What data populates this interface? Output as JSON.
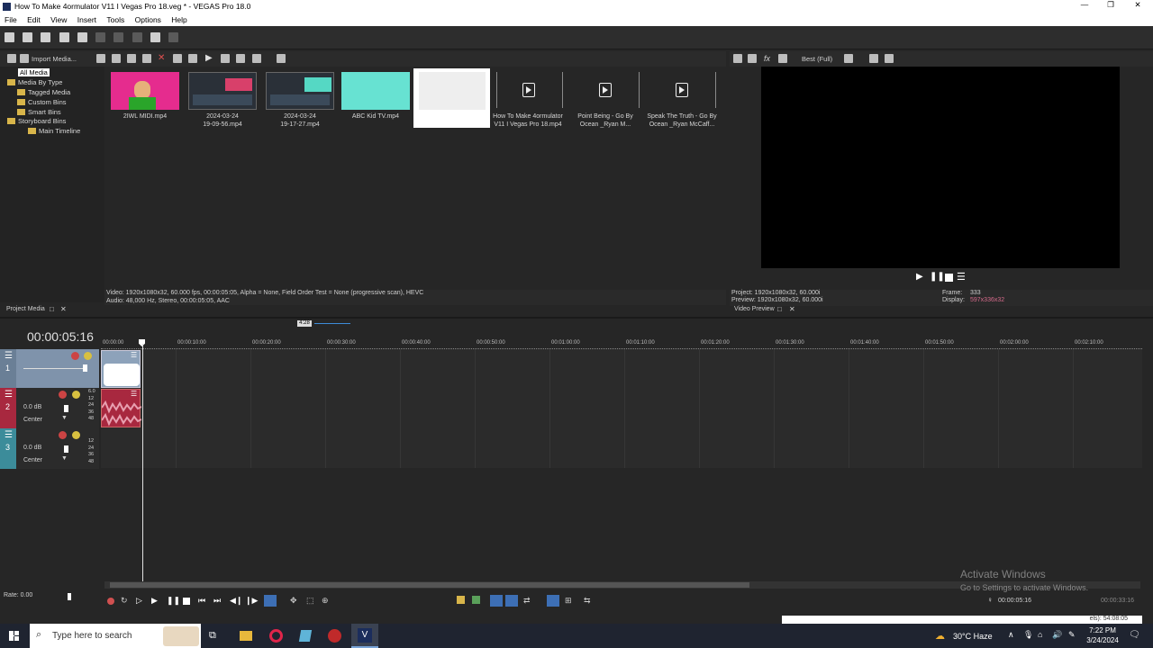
{
  "window": {
    "title": "How To Make 4ormulator V11 I Vegas Pro 18.veg * - VEGAS Pro 18.0"
  },
  "menu": [
    "File",
    "Edit",
    "View",
    "Insert",
    "Tools",
    "Options",
    "Help"
  ],
  "project_media": {
    "import_label": "Import Media...",
    "tree": [
      "All Media",
      "Media By Type",
      "Tagged Media",
      "Custom Bins",
      "Smart Bins",
      "Storyboard Bins",
      "Main Timeline"
    ],
    "items": [
      {
        "label": "2IWL MIDI.mp4"
      },
      {
        "label": "2024-03-24\n19-09-56.mp4"
      },
      {
        "label": "2024-03-24\n19-17-27.mp4"
      },
      {
        "label": "ABC Kid TV.mp4"
      },
      {
        "label": ""
      },
      {
        "label": "How To Make 4ormulator\nV11 I Vegas Pro 18.mp4"
      },
      {
        "label": "Point Being - Go By\nOcean _Ryan M..."
      },
      {
        "label": "Speak The Truth - Go By\nOcean _Ryan McCaff..."
      }
    ],
    "info_video": "Video: 1920x1080x32, 60.000 fps, 00:00:05:05, Alpha = None, Field Order Test = None (progressive scan), HEVC",
    "info_audio": "Audio: 48,000 Hz, Stereo, 00:00:05:05, AAC",
    "tab": "Project Media"
  },
  "preview": {
    "quality": "Best (Full)",
    "project": "Project:  1920x1080x32, 60.000i",
    "preview": "Preview:  1920x1080x32, 60.000i",
    "frame_label": "Frame:",
    "frame": "333",
    "display_label": "Display:",
    "display": "597x336x32",
    "tab": "Video Preview"
  },
  "timeline": {
    "timecode": "00:00:05:16",
    "loop_marker": "4:28",
    "ruler": [
      "00:00:00",
      "00:00:10:00",
      "00:00:20:00",
      "00:00:30:00",
      "00:00:40:00",
      "00:00:50:00",
      "00:01:00:00",
      "00:01:10:00",
      "00:01:20:00",
      "00:01:30:00",
      "00:01:40:00",
      "00:01:50:00",
      "00:02:00:00",
      "00:02:10:00"
    ],
    "tracks": [
      {
        "num": "1",
        "type": "video"
      },
      {
        "num": "2",
        "vol": "0.0 dB",
        "pan": "Center",
        "type": "audio"
      },
      {
        "num": "3",
        "vol": "0.0 dB",
        "pan": "Center",
        "type": "audio"
      }
    ],
    "db_scale": [
      "6.0",
      "12",
      "24",
      "36",
      "48"
    ],
    "rate": "Rate: 0.00",
    "cursor_time": "00:00:05:16",
    "end_time": "00:00:33:16",
    "record_time": "els): 54:08:05"
  },
  "watermark": {
    "line1": "Activate Windows",
    "line2": "Go to Settings to activate Windows."
  },
  "taskbar": {
    "search_placeholder": "Type here to search",
    "weather": "30°C  Haze",
    "time": "7:22 PM",
    "date": "3/24/2024"
  },
  "colors": {
    "video_track": "#7f93ab",
    "audio_track1": "#a8283f",
    "audio_track2": "#3c8c9a",
    "accent": "#f0d23a"
  }
}
